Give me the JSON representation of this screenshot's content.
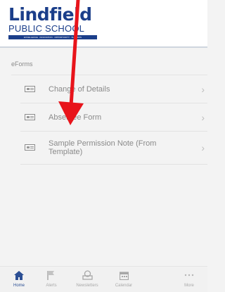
{
  "header": {
    "logo_main": "Lindfield",
    "logo_sub": "PUBLIC SCHOOL",
    "logo_tagline": "EXCELLENCE · INNOVATION · OPPORTUNITY · SUCCESS"
  },
  "section": {
    "title": "eForms"
  },
  "list": {
    "items": [
      {
        "label": "Change of Details"
      },
      {
        "label": "Absentee Form"
      },
      {
        "label": "Sample Permission Note (From Template)"
      }
    ],
    "chevron": "›"
  },
  "bottom_nav": {
    "items": [
      {
        "label": "Home",
        "icon": "home-icon"
      },
      {
        "label": "Alerts",
        "icon": "flag-icon"
      },
      {
        "label": "Newsletters",
        "icon": "newsletter-icon"
      },
      {
        "label": "Calendar",
        "icon": "calendar-icon"
      },
      {
        "label": "More",
        "icon": "more-icon"
      }
    ]
  },
  "colors": {
    "brand": "#1b3e8a",
    "annotation": "#e8141b",
    "active_nav": "#2c4f94"
  }
}
